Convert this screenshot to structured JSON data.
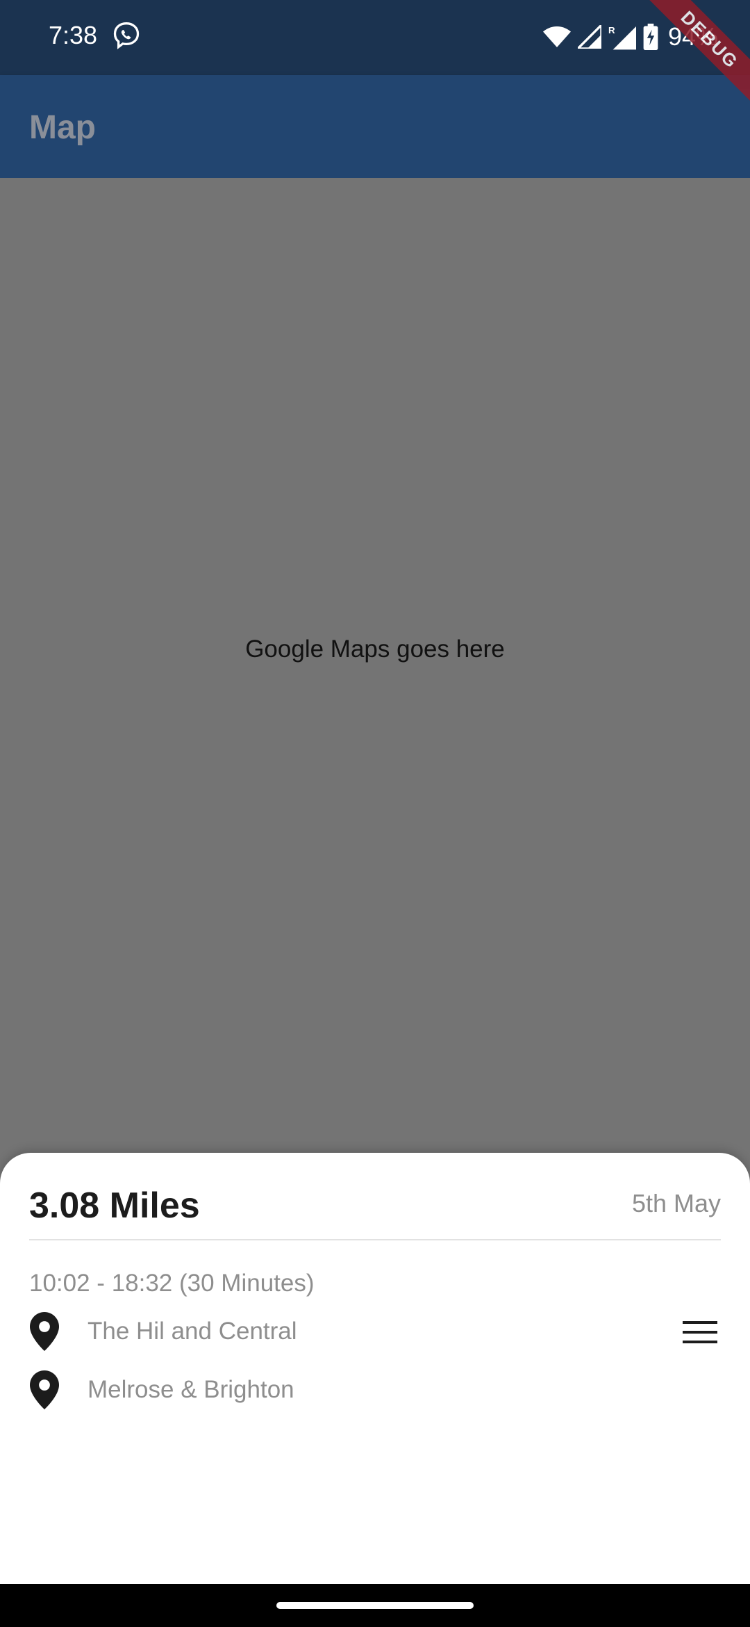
{
  "status_bar": {
    "time": "7:38",
    "battery": "94%",
    "icons": [
      "viber-icon",
      "wifi-icon",
      "signal-icon",
      "roaming-signal-icon",
      "battery-charging-icon"
    ]
  },
  "debug_banner": "DEBUG",
  "app_bar": {
    "title": "Map"
  },
  "map": {
    "placeholder": "Google Maps goes here"
  },
  "trip": {
    "distance": "3.08 Miles",
    "date": "5th May",
    "time_range": "10:02 - 18:32 (30 Minutes)",
    "locations": [
      {
        "name": "The Hil and Central",
        "icon": "location-pin-icon"
      },
      {
        "name": "Melrose & Brighton",
        "icon": "location-pin-icon"
      }
    ],
    "menu_icon": "menu-icon"
  },
  "colors": {
    "status_bar": "#1b3350",
    "app_bar": "#224570",
    "map_background": "#747474",
    "debug_ribbon": "#8f1d2a"
  }
}
